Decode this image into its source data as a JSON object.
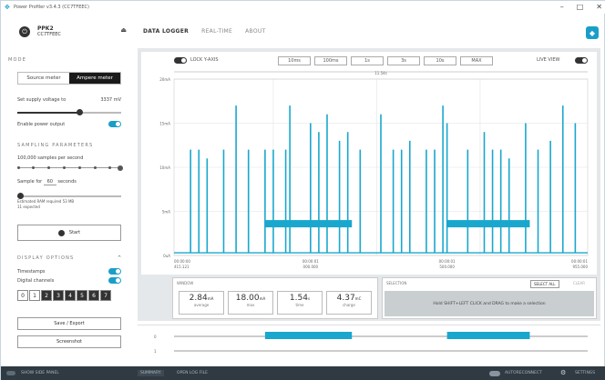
{
  "window": {
    "title": "Power Profiler v3.4.3 (CC7TFEEC)",
    "controls": {
      "minimize": "–",
      "maximize": "□",
      "close": "✕"
    }
  },
  "device": {
    "name": "PPK2",
    "serial": "CC7TFEEC"
  },
  "nav": {
    "tabs": [
      "DATA LOGGER",
      "REAL-TIME",
      "ABOUT"
    ],
    "active": 0
  },
  "sidebar": {
    "mode_title": "MODE",
    "mode_options": [
      "Source meter",
      "Ampere meter"
    ],
    "mode_selected": 1,
    "supply_label": "Set supply voltage to",
    "supply_value": "3337",
    "supply_unit": "mV",
    "supply_fraction": 0.6,
    "power_label": "Enable power output",
    "sampling_title": "SAMPLING PARAMETERS",
    "samples_label": "100,000 samples per second",
    "sample_for_prefix": "Sample for",
    "sample_for_value": "60",
    "sample_for_unit": "seconds",
    "ram_line1": "Estimated RAM required 53 MB",
    "ram_line2": "11 expected",
    "start_label": "Start",
    "display_title": "DISPLAY OPTIONS",
    "timestamps_label": "Timestamps",
    "digital_label": "Digital channels",
    "channels": [
      "0",
      "1",
      "2",
      "3",
      "4",
      "5",
      "6",
      "7"
    ],
    "channels_on": [
      false,
      false,
      true,
      true,
      true,
      true,
      true,
      true
    ],
    "save_label": "Save / Export",
    "screenshot_label": "Screenshot"
  },
  "chart_toolbar": {
    "lock_label": "LOCK Y-AXIS",
    "window_buttons": [
      "10ms",
      "100ms",
      "1s",
      "3s",
      "10s",
      "MAX"
    ],
    "live_label": "LIVE VIEW",
    "span_label": "11.54s"
  },
  "stats": {
    "window_label": "WINDOW",
    "items": [
      {
        "value": "2.84",
        "unit": "mA",
        "label": "average"
      },
      {
        "value": "18.00",
        "unit": "mA",
        "label": "max"
      },
      {
        "value": "1.54",
        "unit": "s",
        "label": "time"
      },
      {
        "value": "4.37",
        "unit": "mC",
        "label": "charge"
      }
    ]
  },
  "selection": {
    "title": "SELECTION",
    "select_all": "SELECT ALL",
    "clear": "CLEAR",
    "hint": "Hold SHIFT+LEFT CLICK and DRAG to make a selection"
  },
  "digital_channels": [
    "0",
    "1"
  ],
  "footer": {
    "left": "SHOW SIDE PANEL",
    "tabs": [
      "SUMMARY",
      "OPEN LOG FILE"
    ],
    "autoreconnect": "AUTORECONNECT",
    "settings": "SETTINGS"
  },
  "colors": {
    "accent": "#1a9ec9",
    "trace": "#19a7ce",
    "footer": "#2f3a42"
  },
  "chart_data": {
    "type": "line",
    "ylabel": "",
    "y_ticks": [
      "20mA",
      "15mA",
      "10mA",
      "5mA",
      "0uA"
    ],
    "x_ticks": [
      {
        "t1": "00:00:00",
        "t2": "415.121"
      },
      {
        "t1": "00:00:01",
        "t2": "000.000"
      },
      {
        "t1": "00:00:01",
        "t2": "500.000"
      },
      {
        "t1": "00:00:01",
        "t2": "955.000"
      }
    ],
    "ylim": [
      0,
      20
    ],
    "baseline_mA": 0.3,
    "spike_times": [
      0.04,
      0.06,
      0.08,
      0.12,
      0.15,
      0.18,
      0.22,
      0.24,
      0.27,
      0.28,
      0.33,
      0.35,
      0.37,
      0.4,
      0.42,
      0.45,
      0.5,
      0.53,
      0.55,
      0.57,
      0.61,
      0.63,
      0.65,
      0.66,
      0.71,
      0.75,
      0.77,
      0.79,
      0.81,
      0.85,
      0.88,
      0.91,
      0.94,
      0.97
    ],
    "spike_values": [
      12,
      12,
      11,
      12,
      17,
      12,
      12,
      12,
      12,
      17,
      15,
      14,
      16,
      13,
      14,
      12,
      16,
      12,
      12,
      13,
      12,
      12,
      17,
      15,
      12,
      14,
      12,
      12,
      11,
      15,
      12,
      13,
      17,
      15
    ],
    "plateaus": [
      {
        "start": 0.22,
        "end": 0.43,
        "value": 3.6
      },
      {
        "start": 0.66,
        "end": 0.86,
        "value": 3.6
      }
    ],
    "digital_high": [
      {
        "start": 0.22,
        "end": 0.43
      },
      {
        "start": 0.66,
        "end": 0.86
      }
    ]
  }
}
